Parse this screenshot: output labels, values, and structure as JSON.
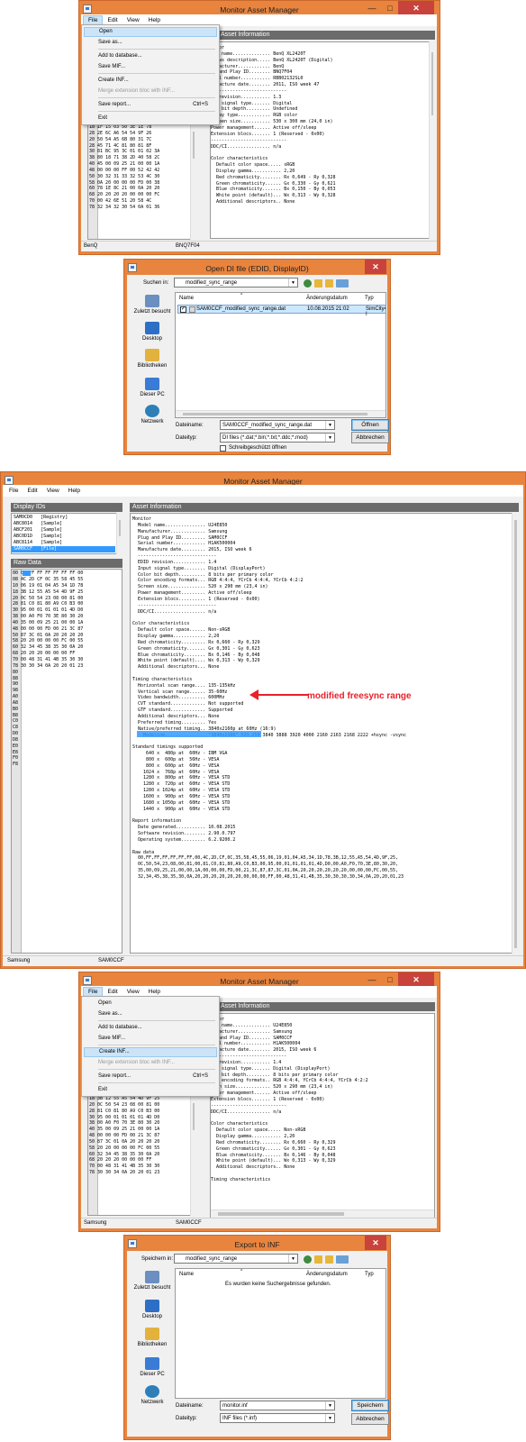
{
  "app": {
    "title": "Monitor Asset Manager",
    "min": "—",
    "max": "□",
    "close": "✕"
  },
  "menubar": {
    "file": "File",
    "edit": "Edit",
    "view": "View",
    "help": "Help"
  },
  "file_menu": {
    "open": "Open",
    "save_as": "Save as...",
    "add_db": "Add to database...",
    "save_mif": "Save MIF...",
    "create_inf": "Create INF...",
    "merge": "Merge extension bloc with INF...",
    "save_report": "Save report...",
    "save_report_shortcut": "Ctrl+S",
    "exit": "Exit"
  },
  "panels": {
    "display_ids": "Display IDs",
    "raw_data": "Raw Data",
    "asset_info": "Asset Information"
  },
  "win1": {
    "asset_lines": [
      "nitor",
      "del name.............. BenQ XL2420T",
      "ndows description..... BenQ XL2420T (Digital)",
      "nufacturer............ BenQ",
      "ug and Play ID........ BNQ7F04",
      "rial number........... RBB02132SL0",
      "nufacture date........ 2011, ISO week 47",
      "----------------------------",
      "ID revision........... 1.3",
      "put signal type....... Digital",
      "lor bit depth......... Undefined",
      "splay type............ RGB color",
      "Screen size........... 530 x 300 mm (24,0 in)",
      "Power management...... Active off/sleep",
      "Extension blocs....... 1 (Reserved - 0x00)",
      "----------------------------",
      "DDC/CI................ n/a",
      "",
      "Color characteristics",
      "  Default color space..... sRGB",
      "  Display gamma........... 2,20",
      "  Red chromaticity........ Rx 0,649 - Ry 0,328",
      "  Green chromaticity...... Gx 0,330 - Gy 0,621",
      "  Blue chromaticity....... Bx 0,150 - By 0,053",
      "  White point (default)... Wx 0,313 - Wy 0,328",
      "  Additional descriptors.. None"
    ],
    "hex_lines": [
      "18 1F 15 03 50 3E 1E 78",
      "28 2E 6C A6 54 54 9F 26",
      "20 50 54 A5 6B 80 31 7C",
      "28 45 71 4C 81 80 81 8F",
      "30 81 BC 95 3C 01 01 02 3A",
      "38 80 18 71 38 2D 40 58 2C",
      "40 45 00 09 25 21 00 00 1A",
      "48 00 00 00 FF 00 52 42 42",
      "50 30 32 31 33 32 53 4C 30",
      "58 0A 20 00 00 00 FD 00 38",
      "60 78 1E 8C 21 00 0A 20 20",
      "68 20 20 20 20 00 00 00 FC",
      "70 00 42 6E 51 20 58 4C",
      "78 32 34 32 30 54 0A 01 36"
    ],
    "status_left": "BenQ",
    "status_right": "BNQ7F04"
  },
  "dlg_open": {
    "title": "Open DI file (EDID, DisplayID)",
    "look_in_label": "Suchen in:",
    "folder": "modified_sync_range",
    "col_name": "Name",
    "col_date": "Änderungsdatum",
    "col_type": "Typ",
    "file_name": "SAM0CCF_modified_sync_range.dat",
    "file_date": "10.08.2015 21:02",
    "file_type": "SimCity4 I",
    "places": [
      "Zuletzt besucht",
      "Desktop",
      "Bibliotheken",
      "Dieser PC",
      "Netzwerk"
    ],
    "filename_label": "Dateiname:",
    "filename_value": "SAM0CCF_modified_sync_range.dat",
    "filetype_label": "Dateityp:",
    "filetype_value": "DI files (*.dat;*.bin;*.txt;*.ddc;*.mod)",
    "readonly_label": "Schreibgeschützt öffnen",
    "ok": "Öffnen",
    "cancel": "Abbrechen"
  },
  "win2": {
    "display_ids": [
      "SAM0CD0   [Registry]",
      "ABC8014   [Sample]",
      "ABCF201   [Sample]",
      "ABC0D1D   [Sample]",
      "ABC8114   [Sample]",
      "SAM0CCF   [File]"
    ],
    "hex_header": "00 00 FF FF FF FF FF FF 00",
    "hex_rows": [
      "08 4C 2D CF 0C 35 58 45 55",
      "10 06 19 01 04 A5 34 1D 78",
      "18 3B 12 55 A5 54 4D 9F 25",
      "20 0C 50 54 23 08 00 81 00",
      "28 81 C0 81 80 A9 C0 B3 00",
      "30 95 00 01 01 01 01 4D D0",
      "38 00 A0 F0 70 3E 80 30 20",
      "40 35 00 09 25 21 00 00 1A",
      "48 00 00 00 FD 00 21 3C 87",
      "50 87 3C 01 0A 20 20 20 20",
      "58 20 20 00 00 00 FC 00 55",
      "60 32 34 45 38 35 30 0A 20",
      "68 20 20 20 00 00 00 FF",
      "70 00 48 31 41 4B 35 30 30",
      "78 30 30 34 0A 20 20 01 23",
      "80 ",
      "88 ",
      "90 ",
      "98 ",
      "A0 ",
      "A8 ",
      "B0 ",
      "B8 ",
      "C0 ",
      "C8 ",
      "D0 ",
      "D8 ",
      "E0 ",
      "E8 ",
      "F0 ",
      "F8 "
    ],
    "asset_lines": [
      "Monitor",
      "  Model name............... U24E850",
      "  Manufacturer............. Samsung",
      "  Plug and Play ID......... SAM0CCF",
      "  Serial number............ H1AK500004",
      "  Manufacture date......... 2015, ISO week 6",
      "  -----------------------------",
      "  EDID revision............ 1.4",
      "  Input signal type........ Digital (DisplayPort)",
      "  Color bit depth.......... 8 bits per primary color",
      "  Color encoding formats... RGB 4:4:4, YCrCb 4:4:4, YCrCb 4:2:2",
      "  Screen size.............. 520 x 290 mm (23,4 in)",
      "  Power management......... Active off/sleep",
      "  Extension blocs.......... 1 (Reserved - 0x00)",
      "  -----------------------------",
      "  DDC/CI................... n/a",
      "",
      "Color characteristics",
      "  Default color space...... Non-sRGB",
      "  Display gamma............ 2,20",
      "  Red chromaticity......... Rx 0,660 - Ry 0,329",
      "  Green chromaticity....... Gx 0,301 - Gy 0,623",
      "  Blue chromaticity........ Bx 0,146 - By 0,048",
      "  White point (default).... Wx 0,313 - Wy 0,329",
      "  Additional descriptors... None",
      "",
      "Timing characteristics",
      "  Horizontal scan range.... 135-135kHz",
      "  Vertical scan range...... 35-60Hz",
      "  Video bandwidth.......... 600MHz",
      "  CVT standard............. Not supported",
      "  GTF standard............. Supported",
      "  Additional descriptors... None",
      "  Preferred timing......... Yes",
      "  Native/preferred timing.. 3840x2160p at 60Hz (16:9)",
      "    Modeline............... \"3840x2160\" 533,250 3840 3888 3920 4000 2160 2163 2168 2222 +hsync -vsync",
      "",
      "Standard timings supported",
      "     640 x  480p at  60Hz - IBM VGA",
      "     800 x  600p at  56Hz - VESA",
      "     800 x  600p at  60Hz - VESA",
      "    1024 x  768p at  60Hz - VESA",
      "    1280 x  800p at  60Hz - VESA STD",
      "    1280 x  720p at  60Hz - VESA STD",
      "    1280 x 1024p at  60Hz - VESA STD",
      "    1600 x  900p at  60Hz - VESA STD",
      "    1680 x 1050p at  60Hz - VESA STD",
      "    1440 x  900p at  60Hz - VESA STD",
      "",
      "Report information",
      "  Date generated........... 10.08.2015",
      "  Software revision........ 2.90.0.797",
      "  Operating system......... 6.2.9200.2",
      "",
      "Raw data",
      "  00,FF,FF,FF,FF,FF,FF,00,4C,2D,CF,0C,35,58,45,55,06,19,01,04,A5,34,1D,78,3B,12,55,A5,54,4D,9F,25,",
      "  0C,50,54,23,08,00,81,00,81,C0,81,80,A9,C0,B3,00,95,00,01,01,01,01,4D,D0,00,A0,F0,70,3E,80,30,20,",
      "  35,00,09,25,21,00,00,1A,00,00,00,FD,00,21,3C,87,87,3C,01,0A,20,20,20,20,20,20,00,00,00,FC,00,55,",
      "  32,34,45,38,35,30,0A,20,20,20,20,20,20,00,00,00,FF,00,48,31,41,4B,35,30,30,30,30,34,0A,20,20,01,23"
    ],
    "annotation": "modified freesync range",
    "status_left": "Samsung",
    "status_right": "SAM0CCF"
  },
  "win3": {
    "asset_lines": [
      "nitor",
      "del name.............. U24E850",
      "nufacturer............ Samsung",
      "ug and Play ID........ SAM0CCF",
      "rial number........... H1AK500004",
      "nufacture date........ 2015, ISO week 6",
      "----------------------------",
      "ID revision........... 1.4",
      "put signal type....... Digital (DisplayPort)",
      "lor bit depth......... 8 bits per primary color",
      "lor encoding formats.. RGB 4:4:4, YCrCb 4:4:4, YCrCb 4:2:2",
      "reen size............. 520 x 290 mm (23,4 in)",
      "Power management...... Active off/sleep",
      "Extension blocs....... 1 (Reserved - 0x00)",
      "----------------------------",
      "DDC/CI................ n/a",
      "",
      "Color characteristics",
      "  Default color space..... Non-sRGB",
      "  Display gamma........... 2,20",
      "  Red chromaticity........ Rx 0,660 - Ry 0,329",
      "  Green chromaticity...... Gx 0,301 - Gy 0,623",
      "  Blue chromaticity....... Bx 0,146 - By 0,048",
      "  White point (default)... Wx 0,313 - Wy 0,329",
      "  Additional descriptors.. None",
      "",
      "Timing characteristics"
    ],
    "hex_lines": [
      "18 3B 12 55 A5 54 4D 9F 25",
      "20 0C 50 54 23 08 00 81 00",
      "28 81 C0 81 80 A9 C0 B3 00",
      "30 95 00 01 01 01 01 4D D0",
      "38 00 A0 F0 70 3E 80 30 20",
      "40 35 00 09 25 21 00 00 1A",
      "48 00 00 00 FD 00 21 3C 87",
      "50 87 3C 01 0A 20 20 20 20",
      "58 20 20 00 00 00 FC 00 55",
      "60 32 34 45 38 35 30 0A 20",
      "68 20 20 20 00 00 00 FF",
      "70 00 48 31 41 4B 35 30 30",
      "78 30 30 34 0A 20 20 01 23"
    ],
    "status_left": "Samsung",
    "status_right": "SAM0CCF"
  },
  "dlg_export": {
    "title": "Export to INF",
    "save_in_label": "Speichern in:",
    "folder": "modified_sync_range",
    "col_name": "Name",
    "col_date": "Änderungsdatum",
    "col_type": "Typ",
    "empty_msg": "Es wurden keine Suchergebnisse gefunden.",
    "places": [
      "Zuletzt besucht",
      "Desktop",
      "Bibliotheken",
      "Dieser PC",
      "Netzwerk"
    ],
    "filename_label": "Dateiname:",
    "filename_value": "monitor.inf",
    "filetype_label": "Dateityp:",
    "filetype_value": "INF files (*.inf)",
    "ok": "Speichern",
    "cancel": "Abbrechen"
  },
  "colors": {
    "frame": "#e8843e",
    "panel_title": "#6b6b6b",
    "selection": "#3399ff",
    "annotation": "#e8212b",
    "close": "#c7433b"
  }
}
